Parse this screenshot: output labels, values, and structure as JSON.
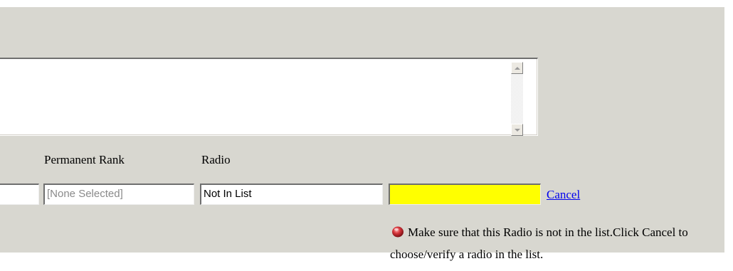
{
  "labels": {
    "permanent_rank": "Permanent Rank",
    "radio": "Radio"
  },
  "fields": {
    "left_value": "",
    "permanent_rank_value": "[None Selected]",
    "radio_value": "Not In List",
    "new_radio_value": ""
  },
  "actions": {
    "cancel_label": "Cancel"
  },
  "message": {
    "icon": "red-warning-icon",
    "text": "Make sure that this Radio is not in the list.Click Cancel to choose/verify a radio in the list."
  },
  "colors": {
    "panel_bg": "#d8d7d0",
    "highlight_field": "#ffff00",
    "link": "#0000ee",
    "warning_icon": "#c0262c"
  }
}
